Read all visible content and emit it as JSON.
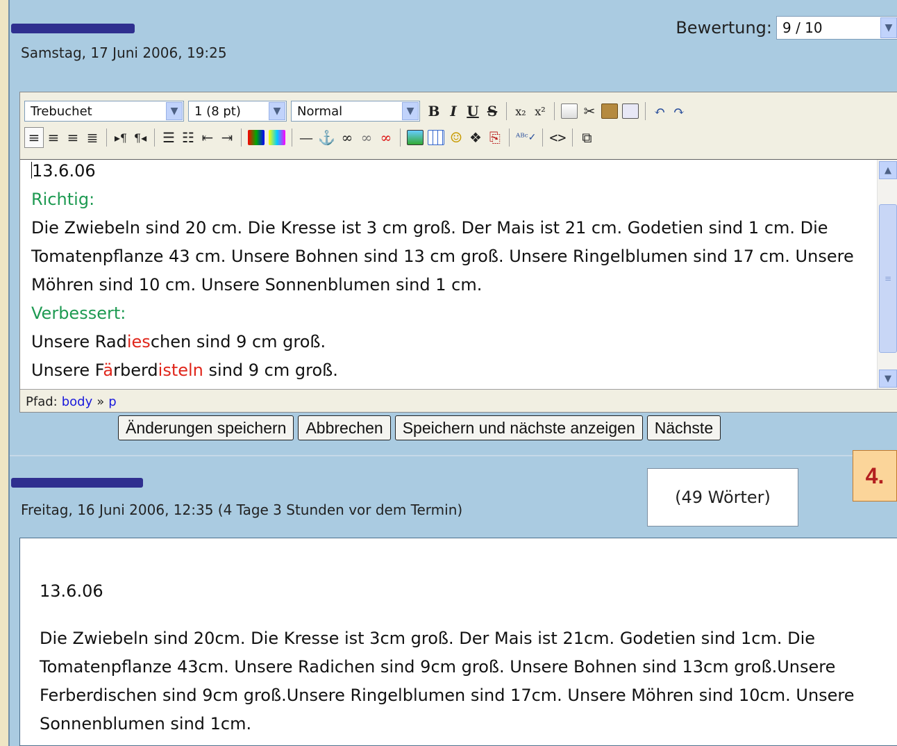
{
  "feedback": {
    "date": "Samstag, 17 Juni 2006, 19:25",
    "grade_label": "Bewertung:",
    "grade_value": "9 / 10"
  },
  "toolbar": {
    "font": "Trebuchet",
    "size": "1 (8 pt)",
    "format": "Normal",
    "bold": "B",
    "italic": "I",
    "underline": "U",
    "strike": "S",
    "subscript": "x₂",
    "superscript": "x²",
    "source_code": "<>",
    "icons_row1": [
      "copy-icon",
      "cut-icon",
      "paste-icon",
      "paste-word-icon",
      "undo-icon",
      "redo-icon"
    ],
    "icons_row2": [
      "align-left-icon",
      "align-center-icon",
      "align-right-icon",
      "justify-icon",
      "ltr-icon",
      "rtl-icon",
      "ordered-list-icon",
      "unordered-list-icon",
      "outdent-icon",
      "indent-icon",
      "text-color-icon",
      "background-color-icon",
      "horizontal-rule-icon",
      "anchor-icon",
      "link-icon",
      "unlink-icon",
      "nolink-icon",
      "image-icon",
      "table-icon",
      "smiley-icon",
      "special-char-icon",
      "search-replace-icon",
      "spellcheck-icon",
      "source-icon",
      "fullscreen-icon"
    ]
  },
  "editor": {
    "line_date": "13.6.06",
    "richtig_label": "Richtig:",
    "richtig_text": "Die Zwiebeln sind 20 cm. Die Kresse ist 3 cm groß. Der Mais ist 21 cm. Godetien sind 1 cm. Die Tomatenpflanze 43 cm. Unsere Bohnen sind 13 cm groß. Unsere Ringelblumen sind 17 cm. Unsere Möhren sind 10 cm. Unsere Sonnenblumen sind 1 cm.",
    "verbessert_label": "Verbessert:",
    "line1_a": "Unsere Rad",
    "line1_b": "ies",
    "line1_c": "chen sind 9 cm groß.",
    "line2_a": "Unsere F",
    "line2_b": "ä",
    "line2_c": "rberd",
    "line2_d": "isteln",
    "line2_e": " sind 9 cm groß."
  },
  "pathbar": {
    "label": "Pfad:",
    "body": "body",
    "sep": "»",
    "p": "p"
  },
  "buttons": {
    "save": "Änderungen speichern",
    "cancel": "Abbrechen",
    "save_next": "Speichern und nächste anzeigen",
    "next": "Nächste"
  },
  "submission": {
    "date": "Freitag, 16 Juni 2006, 12:35 (4 Tage 3 Stunden vor dem Termin)",
    "word_count": "(49 Wörter)",
    "number_badge": "4.",
    "line_date": "13.6.06",
    "text": "Die Zwiebeln sind 20cm. Die Kresse ist 3cm groß. Der Mais ist 21cm. Godetien sind 1cm. Die Tomatenpflanze 43cm. Unsere Radichen sind 9cm groß. Unsere Bohnen sind 13cm groß.Unsere Ferberdischen sind 9cm groß.Unsere Ringelblumen sind 17cm. Unsere Möhren sind 10cm. Unsere Sonnenblumen sind 1cm."
  },
  "colors": {
    "panel": "#aacbe1",
    "page_bg": "#efe6c4",
    "green_label": "#1e9a52",
    "red_highlight": "#e0261b",
    "redaction": "#2f2f8f",
    "badge_bg": "#fbd59a",
    "badge_text": "#b31f1f"
  }
}
